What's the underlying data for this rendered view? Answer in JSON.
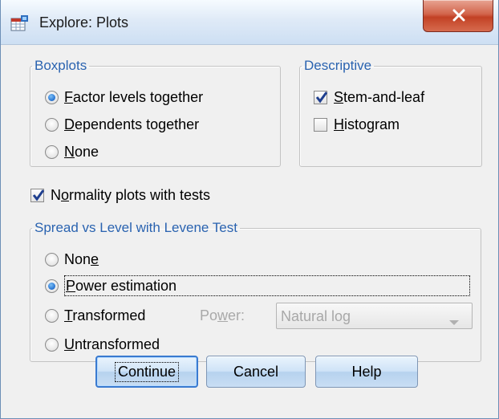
{
  "window": {
    "title": "Explore: Plots",
    "close_symbol": "x",
    "icon": "spss-table-icon"
  },
  "boxplots": {
    "legend": "Boxplots",
    "options": [
      {
        "pre": "",
        "u": "F",
        "post": "actor levels together",
        "checked": true
      },
      {
        "pre": "",
        "u": "D",
        "post": "ependents together",
        "checked": false
      },
      {
        "pre": "",
        "u": "N",
        "post": "one",
        "checked": false
      }
    ]
  },
  "descriptive": {
    "legend": "Descriptive",
    "options": [
      {
        "pre": "",
        "u": "S",
        "post": "tem-and-leaf",
        "checked": true
      },
      {
        "pre": "",
        "u": "H",
        "post": "istogram",
        "checked": false
      }
    ]
  },
  "normality": {
    "pre": "N",
    "u": "o",
    "post": "rmality plots with tests",
    "checked": true
  },
  "spread": {
    "legend": "Spread vs Level with Levene Test",
    "options": [
      {
        "pre": "Non",
        "u": "e",
        "post": "",
        "checked": false
      },
      {
        "pre": "",
        "u": "P",
        "post": "ower estimation",
        "checked": true
      },
      {
        "pre": "",
        "u": "T",
        "post": "ransformed",
        "checked": false
      },
      {
        "pre": "",
        "u": "U",
        "post": "ntransformed",
        "checked": false
      }
    ],
    "power": {
      "pre": "Po",
      "u": "w",
      "post": "er:"
    },
    "power_select_value": "Natural log"
  },
  "buttons": {
    "continue": "Continue",
    "cancel": "Cancel",
    "help": "Help"
  }
}
